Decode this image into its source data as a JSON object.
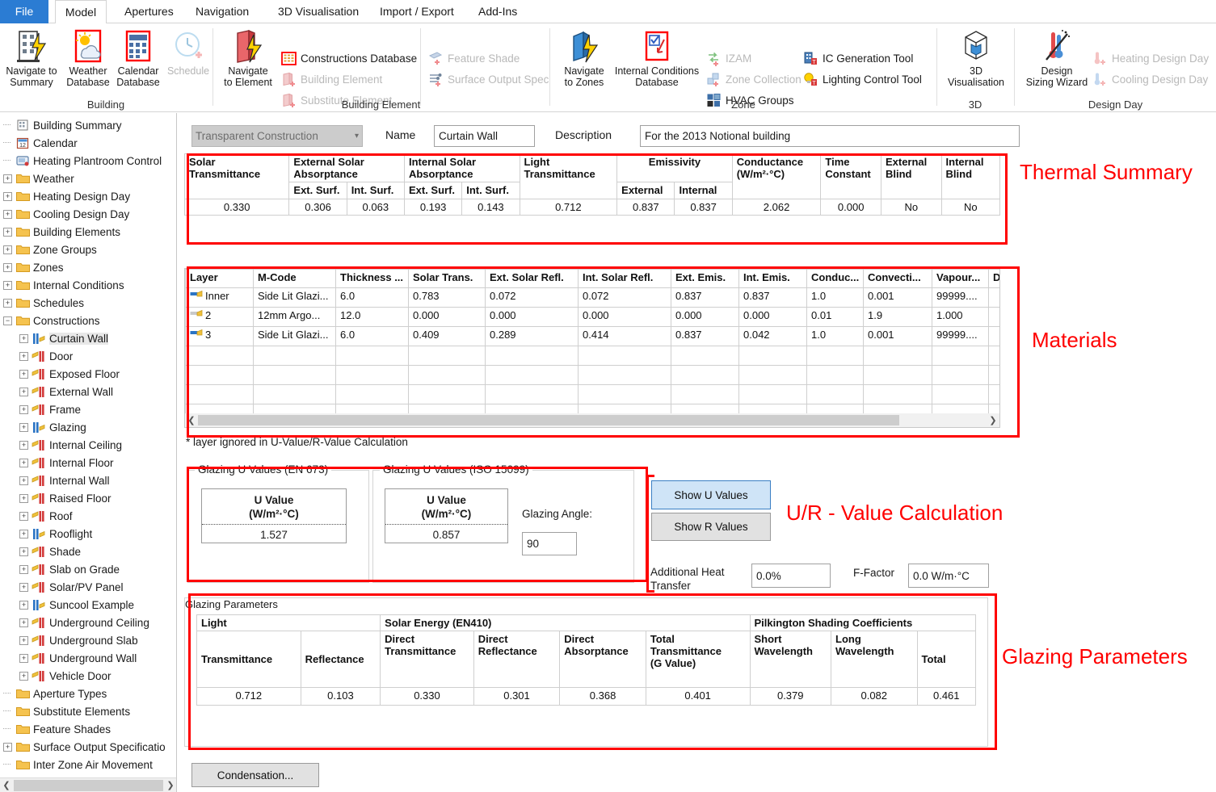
{
  "ribbon": {
    "tabs": [
      {
        "label": "File",
        "active": false,
        "file": true
      },
      {
        "label": "Model",
        "active": true
      },
      {
        "label": "Apertures",
        "active": false
      },
      {
        "label": "Navigation",
        "active": false
      },
      {
        "label": "3D Visualisation",
        "active": false
      },
      {
        "label": "Import / Export",
        "active": false
      },
      {
        "label": "Add-Ins",
        "active": false
      }
    ],
    "groups": [
      {
        "name": "Building",
        "label": "Building"
      },
      {
        "name": "Building Element",
        "label": "Building Element"
      },
      {
        "name": "Zone",
        "label": "Zone"
      },
      {
        "name": "3D",
        "label": "3D"
      },
      {
        "name": "Design Day",
        "label": "Design Day"
      }
    ],
    "building": {
      "navigate_to_summary": "Navigate to\nSummary",
      "navigate_to_summary_l1": "Navigate to",
      "navigate_to_summary_l2": "Summary",
      "weather_database_l1": "Weather",
      "weather_database_l2": "Database",
      "calendar_database_l1": "Calendar",
      "calendar_database_l2": "Database",
      "schedule": "Schedule"
    },
    "building_element": {
      "navigate_to_element_l1": "Navigate",
      "navigate_to_element_l2": "to Element",
      "constructions_database": "Constructions Database",
      "building_element": "Building Element",
      "substitute_element": "Substitute Element",
      "feature_shade": "Feature Shade",
      "surface_output_spec": "Surface Output Spec"
    },
    "zone": {
      "navigate_to_zones_l1": "Navigate",
      "navigate_to_zones_l2": "to Zones",
      "internal_conditions_db_l1": "Internal Conditions",
      "internal_conditions_db_l2": "Database",
      "izam": "IZAM",
      "zone_collection": "Zone Collection",
      "hvac_groups": "HVAC Groups",
      "ic_generation_tool": "IC Generation Tool",
      "lighting_control_tool": "Lighting Control Tool"
    },
    "threed": {
      "visualisation_l1": "3D",
      "visualisation_l2": "Visualisation"
    },
    "design_day": {
      "design_sizing_wizard_l1": "Design",
      "design_sizing_wizard_l2": "Sizing Wizard",
      "heating_design_day": "Heating Design Day",
      "cooling_design_day": "Cooling Design Day"
    }
  },
  "sidebar": {
    "items": [
      {
        "label": "Building Summary",
        "icon": "building-summary-icon",
        "indent": 0,
        "expander": "none"
      },
      {
        "label": "Calendar",
        "icon": "calendar-icon",
        "indent": 0,
        "expander": "none"
      },
      {
        "label": "Heating Plantroom Control",
        "icon": "plantroom-icon",
        "indent": 0,
        "expander": "none"
      },
      {
        "label": "Weather",
        "icon": "folder-icon",
        "indent": 0,
        "expander": "plus"
      },
      {
        "label": "Heating Design Day",
        "icon": "folder-icon",
        "indent": 0,
        "expander": "plus"
      },
      {
        "label": "Cooling Design Day",
        "icon": "folder-icon",
        "indent": 0,
        "expander": "plus"
      },
      {
        "label": "Building Elements",
        "icon": "folder-icon",
        "indent": 0,
        "expander": "plus"
      },
      {
        "label": "Zone Groups",
        "icon": "folder-icon",
        "indent": 0,
        "expander": "plus"
      },
      {
        "label": "Zones",
        "icon": "folder-icon",
        "indent": 0,
        "expander": "plus"
      },
      {
        "label": "Internal Conditions",
        "icon": "folder-icon",
        "indent": 0,
        "expander": "plus"
      },
      {
        "label": "Schedules",
        "icon": "folder-icon",
        "indent": 0,
        "expander": "plus"
      },
      {
        "label": "Constructions",
        "icon": "folder-icon",
        "indent": 0,
        "expander": "minus"
      },
      {
        "label": "Curtain Wall",
        "icon": "glazing-icon",
        "indent": 1,
        "expander": "plus",
        "selected": true
      },
      {
        "label": "Door",
        "icon": "opaque-icon",
        "indent": 1,
        "expander": "plus"
      },
      {
        "label": "Exposed Floor",
        "icon": "opaque-icon",
        "indent": 1,
        "expander": "plus"
      },
      {
        "label": "External Wall",
        "icon": "opaque-icon",
        "indent": 1,
        "expander": "plus"
      },
      {
        "label": "Frame",
        "icon": "opaque-icon",
        "indent": 1,
        "expander": "plus"
      },
      {
        "label": "Glazing",
        "icon": "glazing-icon",
        "indent": 1,
        "expander": "plus"
      },
      {
        "label": "Internal Ceiling",
        "icon": "opaque-icon",
        "indent": 1,
        "expander": "plus"
      },
      {
        "label": "Internal Floor",
        "icon": "opaque-icon",
        "indent": 1,
        "expander": "plus"
      },
      {
        "label": "Internal Wall",
        "icon": "opaque-icon",
        "indent": 1,
        "expander": "plus"
      },
      {
        "label": "Raised Floor",
        "icon": "opaque-icon",
        "indent": 1,
        "expander": "plus"
      },
      {
        "label": "Roof",
        "icon": "opaque-icon",
        "indent": 1,
        "expander": "plus"
      },
      {
        "label": "Rooflight",
        "icon": "glazing-icon",
        "indent": 1,
        "expander": "plus"
      },
      {
        "label": "Shade",
        "icon": "opaque-icon",
        "indent": 1,
        "expander": "plus"
      },
      {
        "label": "Slab on Grade",
        "icon": "opaque-icon",
        "indent": 1,
        "expander": "plus"
      },
      {
        "label": "Solar/PV Panel",
        "icon": "opaque-icon",
        "indent": 1,
        "expander": "plus"
      },
      {
        "label": "Suncool Example",
        "icon": "glazing-icon",
        "indent": 1,
        "expander": "plus"
      },
      {
        "label": "Underground Ceiling",
        "icon": "opaque-icon",
        "indent": 1,
        "expander": "plus"
      },
      {
        "label": "Underground Slab",
        "icon": "opaque-icon",
        "indent": 1,
        "expander": "plus"
      },
      {
        "label": "Underground Wall",
        "icon": "opaque-icon",
        "indent": 1,
        "expander": "plus"
      },
      {
        "label": "Vehicle Door",
        "icon": "opaque-icon",
        "indent": 1,
        "expander": "plus"
      },
      {
        "label": "Aperture Types",
        "icon": "folder-icon",
        "indent": 0,
        "expander": "none"
      },
      {
        "label": "Substitute Elements",
        "icon": "folder-icon",
        "indent": 0,
        "expander": "none"
      },
      {
        "label": "Feature Shades",
        "icon": "folder-icon",
        "indent": 0,
        "expander": "none"
      },
      {
        "label": "Surface Output Specificatio",
        "icon": "folder-icon",
        "indent": 0,
        "expander": "plus"
      },
      {
        "label": "Inter Zone Air Movement",
        "icon": "folder-icon",
        "indent": 0,
        "expander": "none"
      }
    ]
  },
  "topbar": {
    "construction_type": "Transparent Construction",
    "name_label": "Name",
    "name_value": "Curtain Wall",
    "description_label": "Description",
    "description_value": "For the 2013 Notional building"
  },
  "thermal_summary": {
    "annotation": "Thermal Summary",
    "headers_top": [
      "Solar Transmittance",
      "External Solar Absorptance",
      "Internal Solar Absorptance",
      "Light Transmittance",
      "Emissivity",
      "Conductance (W/m²·°C)",
      "Time Constant",
      "External Blind",
      "Internal Blind"
    ],
    "h_solar_transmittance_l1": "Solar",
    "h_solar_transmittance_l2": "Transmittance",
    "h_ext_solar_abs_l1": "External Solar",
    "h_ext_solar_abs_l2": "Absorptance",
    "h_int_solar_abs_l1": "Internal Solar",
    "h_int_solar_abs_l2": "Absorptance",
    "h_light_trans_l1": "Light",
    "h_light_trans_l2": "Transmittance",
    "h_emissivity": "Emissivity",
    "h_conductance_l1": "Conductance",
    "h_conductance_l2": "(W/m²·°C)",
    "h_time_constant_l1": "Time",
    "h_time_constant_l2": "Constant",
    "h_external_blind_l1": "External",
    "h_external_blind_l2": "Blind",
    "h_internal_blind_l1": "Internal",
    "h_internal_blind_l2": "Blind",
    "sub_ext_surf_1": "Ext. Surf.",
    "sub_int_surf_1": "Int. Surf.",
    "sub_ext_surf_2": "Ext. Surf.",
    "sub_int_surf_2": "Int. Surf.",
    "sub_external": "External",
    "sub_internal": "Internal",
    "values": {
      "solar_transmittance": "0.330",
      "ext_solar_abs_ext": "0.306",
      "ext_solar_abs_int": "0.063",
      "int_solar_abs_ext": "0.193",
      "int_solar_abs_int": "0.143",
      "light_transmittance": "0.712",
      "emissivity_external": "0.837",
      "emissivity_internal": "0.837",
      "conductance": "2.062",
      "time_constant": "0.000",
      "external_blind": "No",
      "internal_blind": "No"
    }
  },
  "materials": {
    "annotation": "Materials",
    "columns": [
      "Layer",
      "M-Code",
      "Thickness ...",
      "Solar Trans.",
      "Ext. Solar Refl.",
      "Int. Solar Refl.",
      "Ext. Emis.",
      "Int. Emis.",
      "Conduc...",
      "Convecti...",
      "Vapour...",
      "D"
    ],
    "rows": [
      {
        "layer": "Inner",
        "icon": "glazing-layer-icon",
        "mcode": "Side Lit Glazi...",
        "thickness": "6.0",
        "solar_trans": "0.783",
        "ext_solar_refl": "0.072",
        "int_solar_refl": "0.072",
        "ext_emis": "0.837",
        "int_emis": "0.837",
        "conduc": "1.0",
        "convect": "0.001",
        "vapour": "99999....",
        "d": ""
      },
      {
        "layer": "2",
        "icon": "gas-layer-icon",
        "mcode": "12mm Argo...",
        "thickness": "12.0",
        "solar_trans": "0.000",
        "ext_solar_refl": "0.000",
        "int_solar_refl": "0.000",
        "ext_emis": "0.000",
        "int_emis": "0.000",
        "conduc": "0.01",
        "convect": "1.9",
        "vapour": "1.000",
        "d": ""
      },
      {
        "layer": "3",
        "icon": "glazing-layer-icon",
        "mcode": "Side Lit Glazi...",
        "thickness": "6.0",
        "solar_trans": "0.409",
        "ext_solar_refl": "0.289",
        "int_solar_refl": "0.414",
        "ext_emis": "0.837",
        "int_emis": "0.042",
        "conduc": "1.0",
        "convect": "0.001",
        "vapour": "99999....",
        "d": ""
      }
    ],
    "footnote": "* layer ignored in U-Value/R-Value Calculation"
  },
  "uvalues": {
    "annotation": "U/R - Value Calculation",
    "en673_caption": "Glazing U Values (EN 673)",
    "iso_caption": "Glazing U Values (ISO 15099)",
    "uvalue_header_l1": "U Value",
    "uvalue_header_l2": "(W/m²·°C)",
    "en673_value": "1.527",
    "iso_value": "0.857",
    "glazing_angle_label": "Glazing Angle:",
    "glazing_angle_value": "90",
    "show_u_values": "Show U Values",
    "show_r_values": "Show R Values",
    "additional_heat_transfer_l1": "Additional Heat",
    "additional_heat_transfer_l2": "Transfer",
    "additional_heat_transfer_value": "0.0%",
    "f_factor_label": "F-Factor",
    "f_factor_value": "0.0 W/m·°C"
  },
  "glazing_parameters": {
    "annotation": "Glazing Parameters",
    "caption": "Glazing Parameters",
    "group_light": "Light",
    "group_solar": "Solar Energy (EN410)",
    "group_pilkington": "Pilkington Shading Coefficients",
    "h_transmittance": "Transmittance",
    "h_reflectance": "Reflectance",
    "h_direct_transmittance_l1": "Direct",
    "h_direct_transmittance_l2": "Transmittance",
    "h_direct_reflectance_l1": "Direct",
    "h_direct_reflectance_l2": "Reflectance",
    "h_direct_absorptance_l1": "Direct",
    "h_direct_absorptance_l2": "Absorptance",
    "h_total_transmittance_l1": "Total",
    "h_total_transmittance_l2": "Transmittance",
    "h_total_transmittance_l3": "(G Value)",
    "h_short_wavelength_l1": "Short",
    "h_short_wavelength_l2": "Wavelength",
    "h_long_wavelength_l1": "Long",
    "h_long_wavelength_l2": "Wavelength",
    "h_total": "Total",
    "values": {
      "light_transmittance": "0.712",
      "light_reflectance": "0.103",
      "direct_transmittance": "0.330",
      "direct_reflectance": "0.301",
      "direct_absorptance": "0.368",
      "total_transmittance": "0.401",
      "short_wavelength": "0.379",
      "long_wavelength": "0.082",
      "total": "0.461"
    }
  },
  "footer": {
    "condensation_button": "Condensation..."
  },
  "colors": {
    "accent_blue": "#2b7cd3",
    "annotation_red": "#ff0000",
    "primary_button": "#cfe4f7"
  }
}
